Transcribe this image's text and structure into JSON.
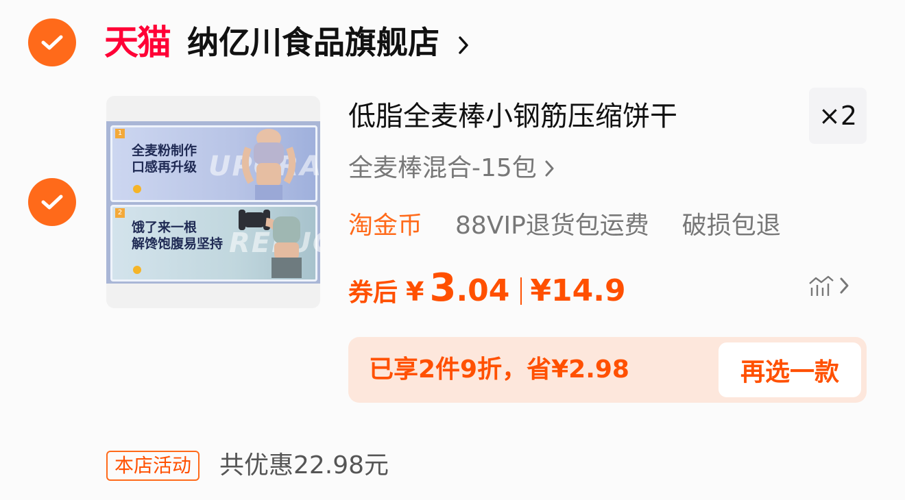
{
  "shop": {
    "brand": "天猫",
    "name": "纳亿川食品旗舰店",
    "brand_color": "#ff0036"
  },
  "product": {
    "image": {
      "panel1_text": "全麦粉制作\n口感再升级",
      "panel1_num": "1",
      "panel1_watermark": "UPGRADE",
      "panel2_text": "饿了来一根\n解馋饱腹易坚持",
      "panel2_num": "2",
      "panel2_watermark": "RELUC"
    },
    "title": "低脂全麦棒小钢筋压缩饼干",
    "quantity": "×2",
    "sku": "全麦棒混合-15包",
    "tags": [
      "淘金币",
      "88VIP退货包运费",
      "破损包退"
    ],
    "price": {
      "label": "券后",
      "currency": "¥",
      "integer": "3",
      "decimal": ".04",
      "original": "¥14.9"
    },
    "promo": {
      "text": "已享2件9折，省¥2.98",
      "button": "再选一款"
    }
  },
  "footer": {
    "badge": "本店活动",
    "discount": "共优惠22.98元"
  },
  "colors": {
    "accent": "#ff5000",
    "check": "#ff6a1a",
    "promo_bg": "#fde7dc"
  },
  "icons": [
    "check-icon",
    "chevron-right-icon",
    "price-trend-icon"
  ]
}
